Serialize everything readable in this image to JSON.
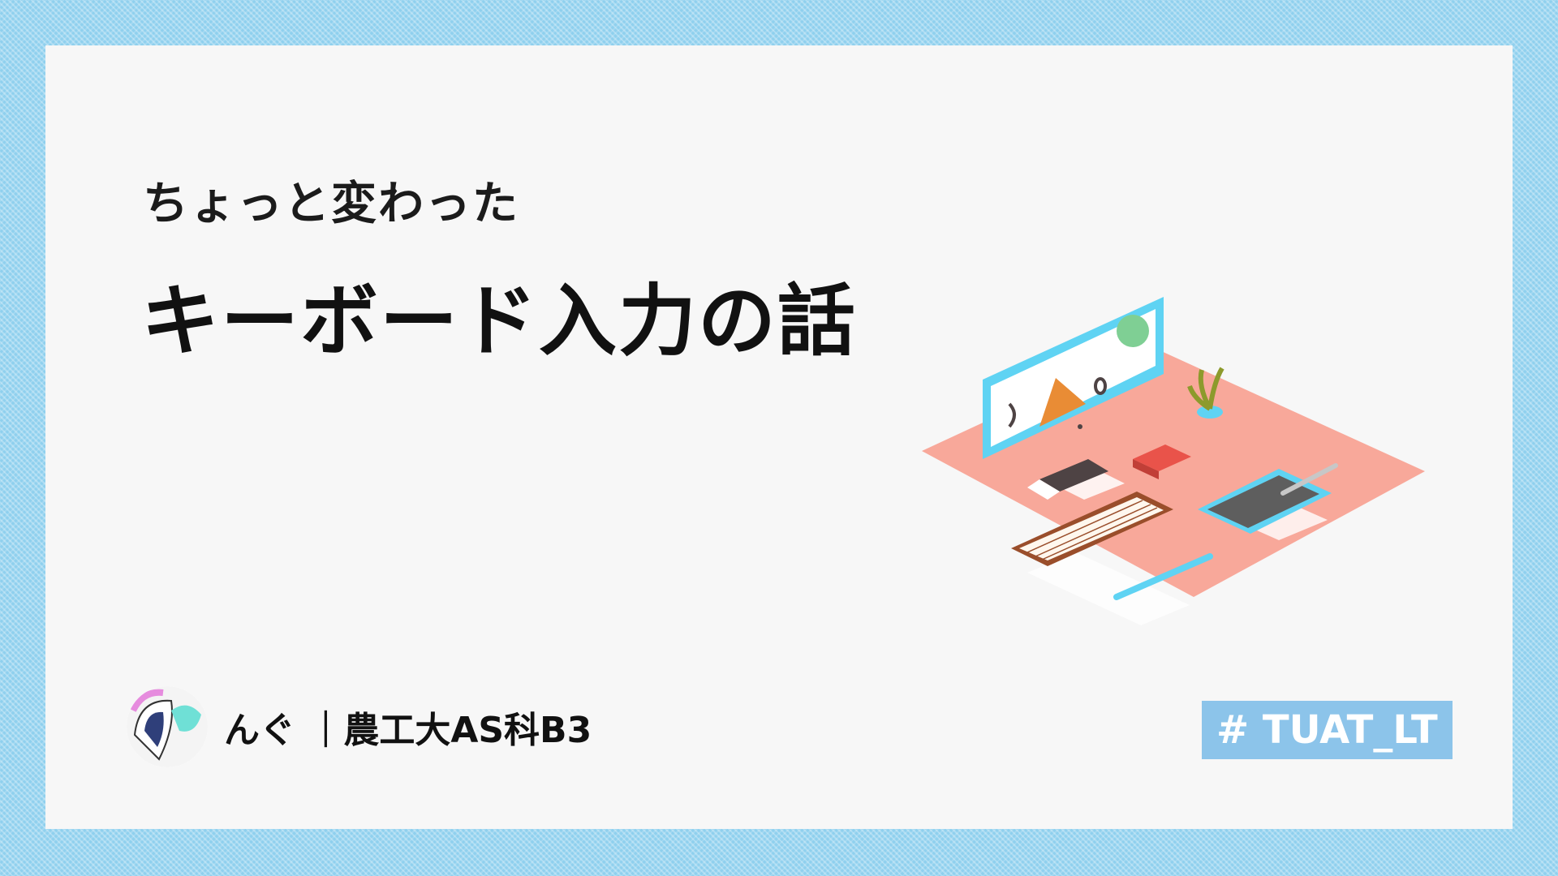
{
  "slide": {
    "subtitle": "ちょっと変わった",
    "title": "キーボード入力の話",
    "author": {
      "text": "んぐ ｜農工大AS科B3",
      "avatar_icon": "avatar-illustration"
    },
    "tag": "# TUAT_LT"
  },
  "colors": {
    "frame": "#8fd0ee",
    "card": "#f7f7f7",
    "tag_bg": "#8cc4ea",
    "mat": "#f8a89a",
    "monitor": "#5fd3f3",
    "accent_orange": "#e98c35",
    "accent_green": "#7fcf94",
    "accent_red": "#e9534a",
    "keyboard_frame": "#9a4e2b"
  },
  "illustration": {
    "icon": "isometric-desk-icon"
  }
}
